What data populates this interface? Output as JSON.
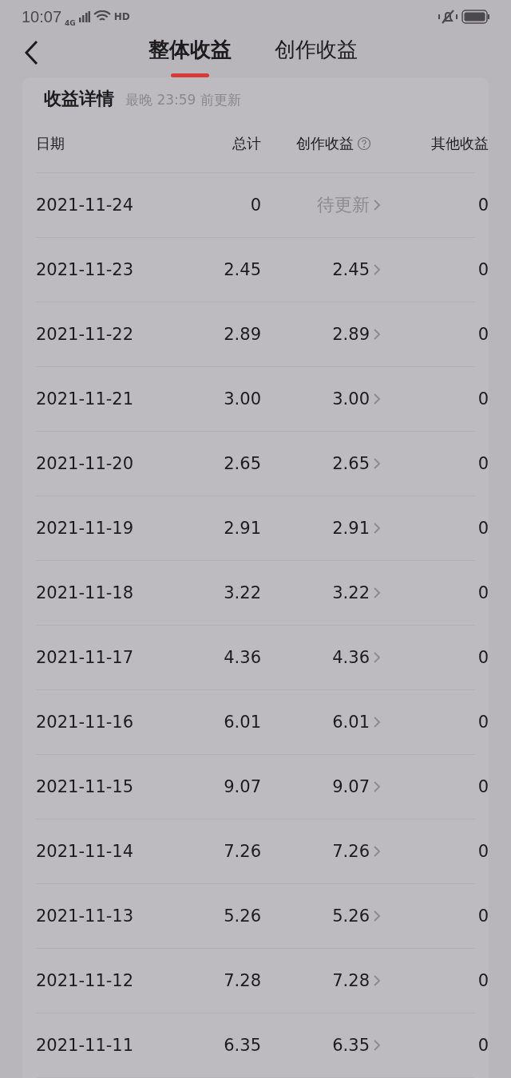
{
  "status_bar": {
    "time": "10:07",
    "network": "4G",
    "hd": "HD"
  },
  "tabs": [
    {
      "label": "整体收益",
      "selected": true
    },
    {
      "label": "创作收益",
      "selected": false
    }
  ],
  "card": {
    "title": "收益详情",
    "note": "最晚 23:59 前更新"
  },
  "table": {
    "columns": [
      "日期",
      "总计",
      "创作收益",
      "其他收益"
    ],
    "rows": [
      {
        "date": "2021-11-24",
        "total": "0",
        "creation": "待更新",
        "kind": "pending",
        "other": "0"
      },
      {
        "date": "2021-11-23",
        "total": "2.45",
        "creation": "2.45",
        "kind": "value",
        "other": "0"
      },
      {
        "date": "2021-11-22",
        "total": "2.89",
        "creation": "2.89",
        "kind": "value",
        "other": "0"
      },
      {
        "date": "2021-11-21",
        "total": "3.00",
        "creation": "3.00",
        "kind": "value",
        "other": "0"
      },
      {
        "date": "2021-11-20",
        "total": "2.65",
        "creation": "2.65",
        "kind": "value",
        "other": "0"
      },
      {
        "date": "2021-11-19",
        "total": "2.91",
        "creation": "2.91",
        "kind": "value",
        "other": "0"
      },
      {
        "date": "2021-11-18",
        "total": "3.22",
        "creation": "3.22",
        "kind": "value",
        "other": "0"
      },
      {
        "date": "2021-11-17",
        "total": "4.36",
        "creation": "4.36",
        "kind": "value",
        "other": "0"
      },
      {
        "date": "2021-11-16",
        "total": "6.01",
        "creation": "6.01",
        "kind": "value",
        "other": "0"
      },
      {
        "date": "2021-11-15",
        "total": "9.07",
        "creation": "9.07",
        "kind": "value",
        "other": "0"
      },
      {
        "date": "2021-11-14",
        "total": "7.26",
        "creation": "7.26",
        "kind": "value",
        "other": "0"
      },
      {
        "date": "2021-11-13",
        "total": "5.26",
        "creation": "5.26",
        "kind": "value",
        "other": "0"
      },
      {
        "date": "2021-11-12",
        "total": "7.28",
        "creation": "7.28",
        "kind": "value",
        "other": "0"
      },
      {
        "date": "2021-11-11",
        "total": "6.35",
        "creation": "6.35",
        "kind": "value",
        "other": "0"
      }
    ]
  }
}
